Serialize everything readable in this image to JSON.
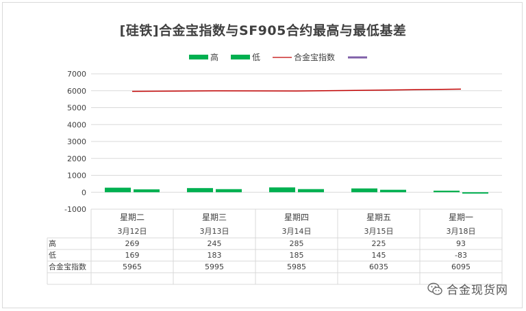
{
  "chart_data": {
    "type": "bar",
    "title": "[硅铁]合金宝指数与SF905合约最高与最低基差",
    "categories": [
      "星期二",
      "星期三",
      "星期四",
      "星期五",
      "星期一"
    ],
    "dates": [
      "3月12日",
      "3月13日",
      "3月14日",
      "3月15日",
      "3月18日"
    ],
    "series": [
      {
        "name": "高",
        "type": "bar",
        "color": "#00b050",
        "values": [
          269,
          245,
          285,
          225,
          93
        ]
      },
      {
        "name": "低",
        "type": "bar",
        "color": "#00b050",
        "values": [
          169,
          183,
          185,
          145,
          -83
        ]
      },
      {
        "name": "合金宝指数",
        "type": "line",
        "color": "#c00000",
        "values": [
          5965,
          5995,
          5985,
          6035,
          6095
        ]
      },
      {
        "name": "",
        "type": "line",
        "color": "#7f5fa8",
        "values": []
      }
    ],
    "ylim": [
      -1000,
      7000
    ],
    "yticks": [
      7000,
      6000,
      5000,
      4000,
      3000,
      2000,
      1000,
      0,
      -1000
    ],
    "grid": true,
    "legend": "top",
    "data_table": true
  },
  "watermark": {
    "text": "合金现货网",
    "icon": "wechat-icon"
  }
}
